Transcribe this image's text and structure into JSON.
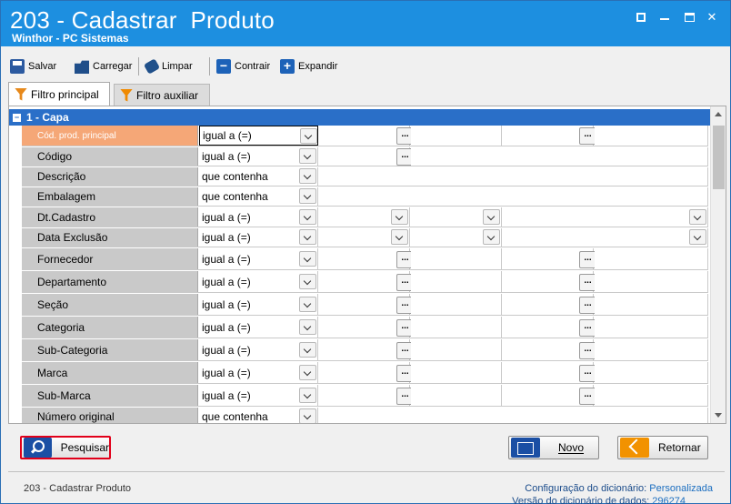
{
  "window": {
    "title": "203 - Cadastrar  Produto",
    "subtitle": "Winthor - PC Sistemas"
  },
  "toolbar": {
    "salvar": "Salvar",
    "carregar": "Carregar",
    "limpar": "Limpar",
    "contrair": "Contrair",
    "expandir": "Expandir"
  },
  "tabs": {
    "principal": "Filtro principal",
    "auxiliar": "Filtro auxiliar"
  },
  "section": {
    "title": "1 - Capa"
  },
  "rows": [
    {
      "label": "Cód. prod. principal",
      "op": "igual a (=)"
    },
    {
      "label": "Código",
      "op": "igual a (=)"
    },
    {
      "label": "Descrição",
      "op": "que contenha"
    },
    {
      "label": "Embalagem",
      "op": "que contenha"
    },
    {
      "label": "Dt.Cadastro",
      "op": "igual a (=)"
    },
    {
      "label": "Data Exclusão",
      "op": "igual a (=)"
    },
    {
      "label": "Fornecedor",
      "op": "igual a (=)"
    },
    {
      "label": "Departamento",
      "op": "igual a (=)"
    },
    {
      "label": "Seção",
      "op": "igual a (=)"
    },
    {
      "label": "Categoria",
      "op": "igual a (=)"
    },
    {
      "label": "Sub-Categoria",
      "op": "igual a (=)"
    },
    {
      "label": "Marca",
      "op": "igual a (=)"
    },
    {
      "label": "Sub-Marca",
      "op": "igual a (=)"
    },
    {
      "label": "Número original",
      "op": "que contenha"
    }
  ],
  "ellipsis": "...",
  "buttons": {
    "pesquisar": "Pesquisar",
    "novo": "Novo",
    "retornar": "Retornar"
  },
  "status": {
    "left": "203 - Cadastrar  Produto",
    "config_label": "Configuração do dicionário:",
    "config_value": "Personalizada",
    "versao_label": "Versão do dicionário de dados:",
    "versao_value": "296274"
  }
}
